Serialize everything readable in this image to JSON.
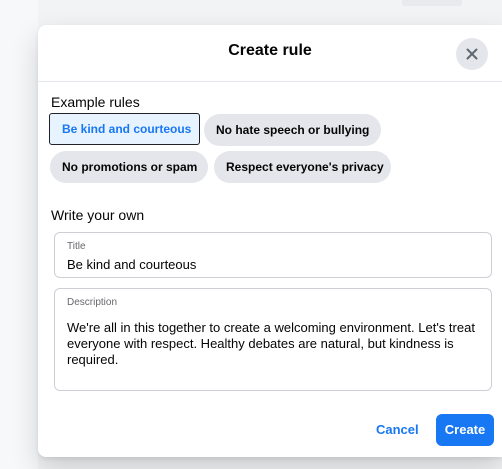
{
  "modal": {
    "title": "Create rule",
    "close_icon": "close-icon",
    "accent_color": "#1877f2"
  },
  "example_rules": {
    "label": "Example rules",
    "chips": [
      {
        "label": "Be kind and courteous",
        "selected": true
      },
      {
        "label": "No hate speech or bullying",
        "selected": false
      },
      {
        "label": "No promotions or spam",
        "selected": false
      },
      {
        "label": "Respect everyone's privacy",
        "selected": false
      }
    ]
  },
  "write_own": {
    "label": "Write your own",
    "title_field": {
      "label": "Title",
      "value": "Be kind and courteous"
    },
    "description_field": {
      "label": "Description",
      "value": "We're all in this together to create a welcoming environment. Let's treat everyone with respect. Healthy debates are natural, but kindness is required."
    }
  },
  "actions": {
    "cancel_label": "Cancel",
    "create_label": "Create"
  }
}
